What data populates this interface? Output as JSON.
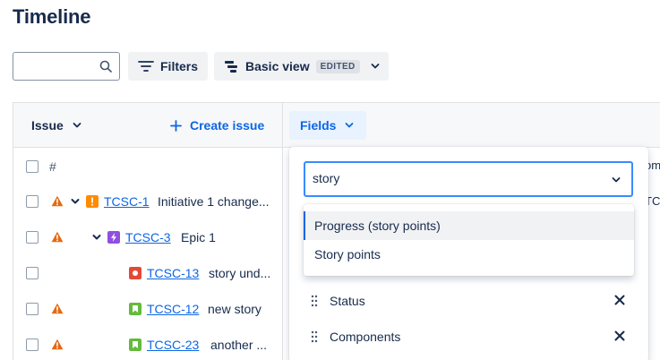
{
  "page": {
    "title": "Timeline"
  },
  "toolbar": {
    "search": {
      "value": "",
      "placeholder": "",
      "icon": "search-icon"
    },
    "filters_label": "Filters",
    "view_label": "Basic view",
    "view_badge": "EDITED"
  },
  "grid": {
    "issue_header": "Issue",
    "create_issue_label": "Create issue",
    "fields_label": "Fields",
    "hash_header": "#",
    "rows": [
      {
        "key": "TCSC-1",
        "summary": "Initiative 1 change...",
        "type": "initiative",
        "warning": true
      },
      {
        "key": "TCSC-3",
        "summary": "Epic 1",
        "type": "epic",
        "warning": true
      },
      {
        "key": "TCSC-13",
        "summary": "story und...",
        "type": "bug",
        "warning": false
      },
      {
        "key": "TCSC-12",
        "summary": "new story",
        "type": "story",
        "warning": true
      },
      {
        "key": "TCSC-23",
        "summary": "another ...",
        "type": "story",
        "warning": true
      }
    ],
    "right_peek": [
      "om",
      "TCS"
    ]
  },
  "fields_panel": {
    "search_value": "story",
    "options": [
      {
        "label": "Progress (story points)",
        "active": true
      },
      {
        "label": "Story points",
        "active": false
      }
    ],
    "fields": [
      {
        "label": "Status"
      },
      {
        "label": "Components"
      }
    ]
  },
  "colors": {
    "accent": "#0c66e4",
    "warning": "#e56910",
    "initiative": "#ff8b00",
    "epic": "#904ee2",
    "bug": "#e34935",
    "story": "#63ba3c"
  }
}
